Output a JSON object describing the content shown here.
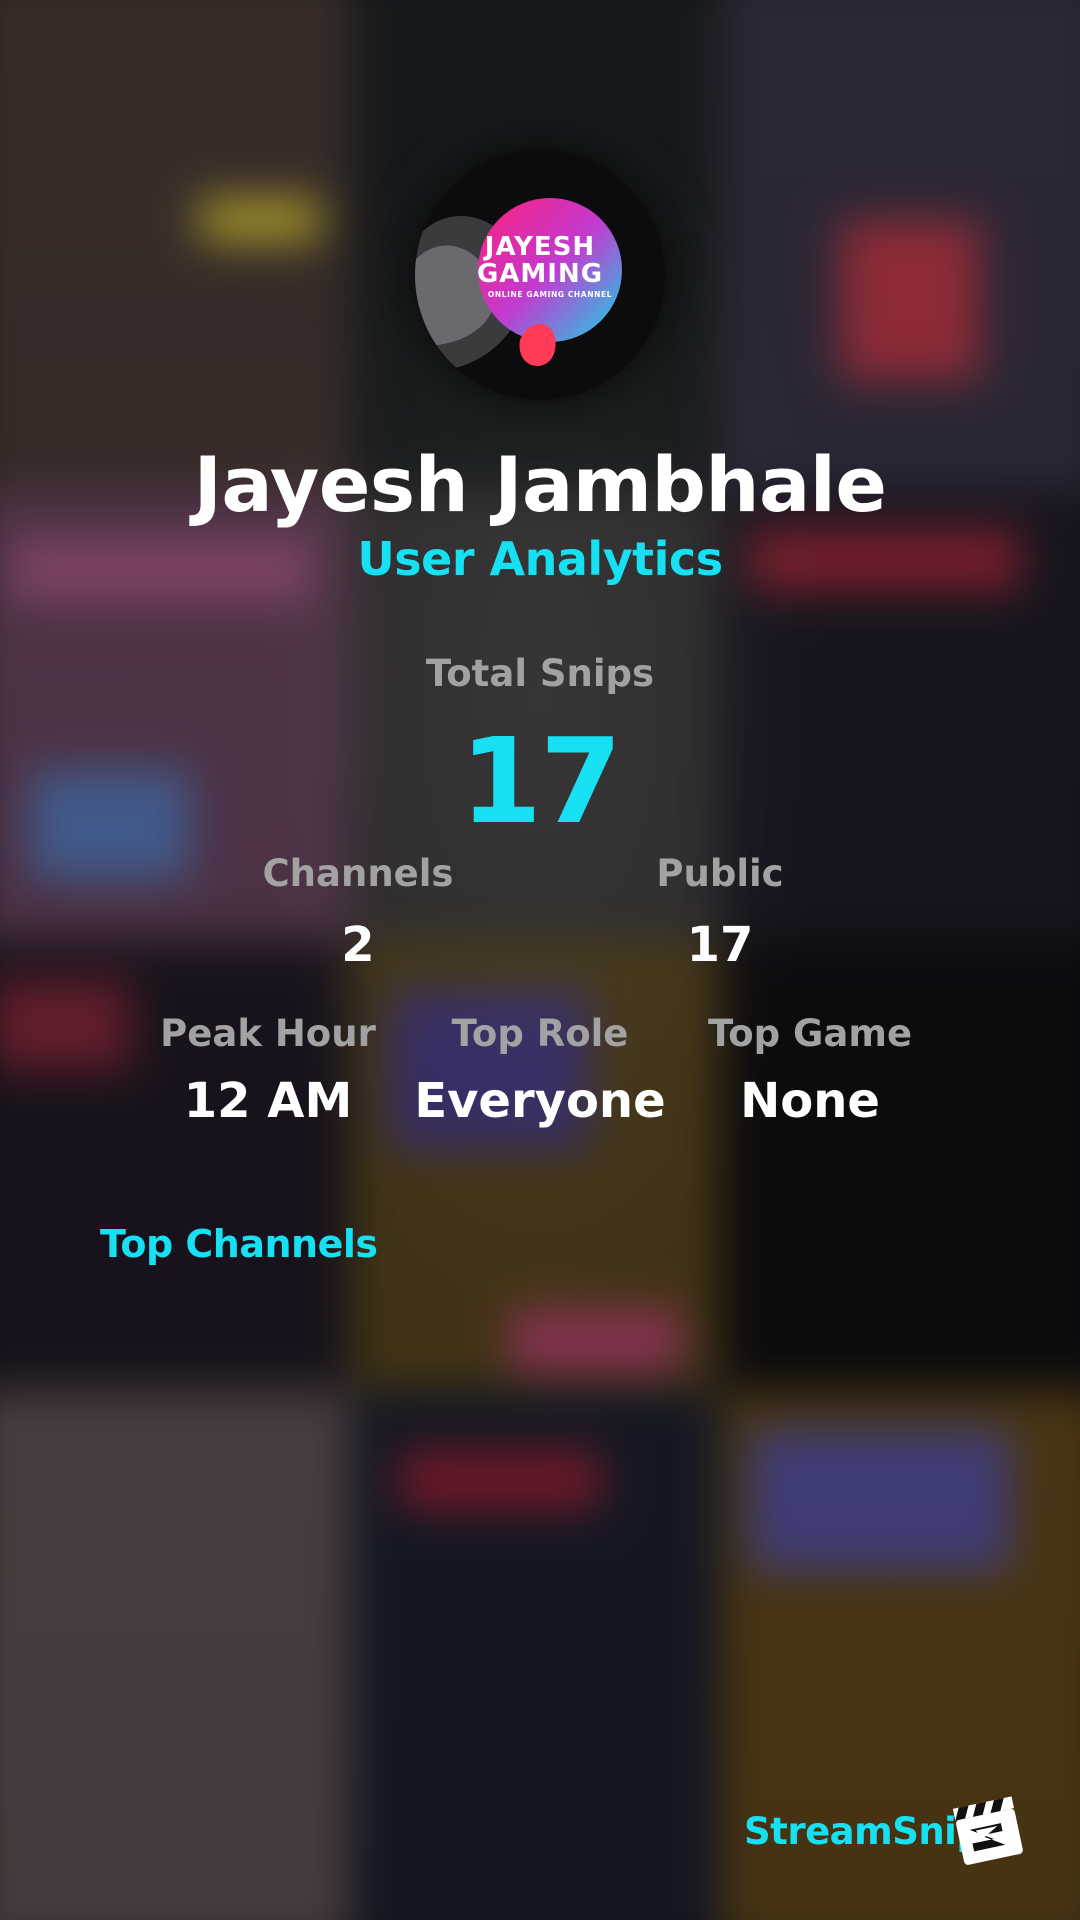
{
  "avatar": {
    "logo_title_line1": "JAYESH",
    "logo_title_line2": "GAMING",
    "logo_subtitle": "ONLINE GAMING CHANNEL",
    "icon": "channel-logo"
  },
  "profile": {
    "name": "Jayesh Jambhale",
    "subtitle": "User Analytics"
  },
  "total": {
    "label": "Total Snips",
    "value": "17"
  },
  "stats_row1": {
    "channels_label": "Channels",
    "channels_value": "2",
    "public_label": "Public",
    "public_value": "17"
  },
  "stats_row2": {
    "peak_label": "Peak Hour",
    "peak_value": "12 AM",
    "role_label": "Top Role",
    "role_value": "Everyone",
    "game_label": "Top Game",
    "game_value": "None"
  },
  "top_channels": {
    "heading": "Top Channels"
  },
  "brand": {
    "name": "StreamSnip",
    "icon": "clapperboard-logo-icon"
  },
  "colors": {
    "accent": "#16e0f2",
    "label": "#a2a2a2",
    "value": "#ffffff"
  }
}
